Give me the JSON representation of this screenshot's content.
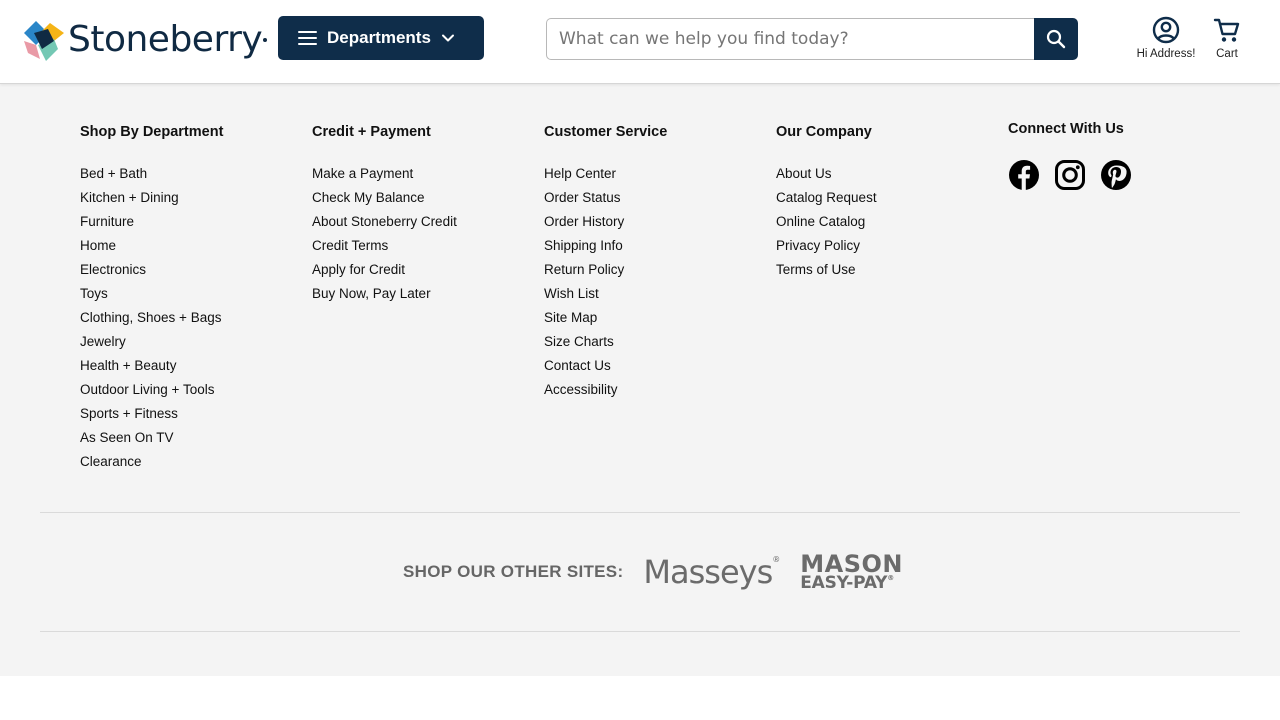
{
  "header": {
    "logo_text": "Stoneberry",
    "departments_label": "Departments",
    "search": {
      "placeholder": "What can we help you find today?",
      "value": ""
    },
    "account_label": "Hi Address!",
    "cart_label": "Cart"
  },
  "footer": {
    "columns": [
      {
        "title": "Shop By Department",
        "links": [
          "Bed + Bath",
          "Kitchen + Dining",
          "Furniture",
          "Home",
          "Electronics",
          "Toys",
          "Clothing, Shoes + Bags",
          "Jewelry",
          "Health + Beauty",
          "Outdoor Living + Tools",
          "Sports + Fitness",
          "As Seen On TV",
          "Clearance"
        ]
      },
      {
        "title": "Credit + Payment",
        "links": [
          "Make a Payment",
          "Check My Balance",
          "About Stoneberry Credit",
          "Credit Terms",
          "Apply for Credit",
          "Buy Now, Pay Later"
        ]
      },
      {
        "title": "Customer Service",
        "links": [
          "Help Center",
          "Order Status",
          "Order History",
          "Shipping Info",
          "Return Policy",
          "Wish List",
          "Site Map",
          "Size Charts",
          "Contact Us",
          "Accessibility"
        ]
      },
      {
        "title": "Our Company",
        "links": [
          "About Us",
          "Catalog Request",
          "Online Catalog",
          "Privacy Policy",
          "Terms of Use"
        ]
      }
    ],
    "connect": {
      "title": "Connect With Us",
      "icons": [
        "facebook-icon",
        "instagram-icon",
        "pinterest-icon"
      ]
    },
    "other_sites": {
      "title": "SHOP OUR OTHER SITES:",
      "masseys": "Masseys",
      "mason_line1": "MASON",
      "mason_line2": "EASY-PAY"
    }
  },
  "colors": {
    "brand_navy": "#0f2d4a",
    "footer_bg": "#f4f4f4",
    "muted_gray": "#6b6b6b"
  }
}
